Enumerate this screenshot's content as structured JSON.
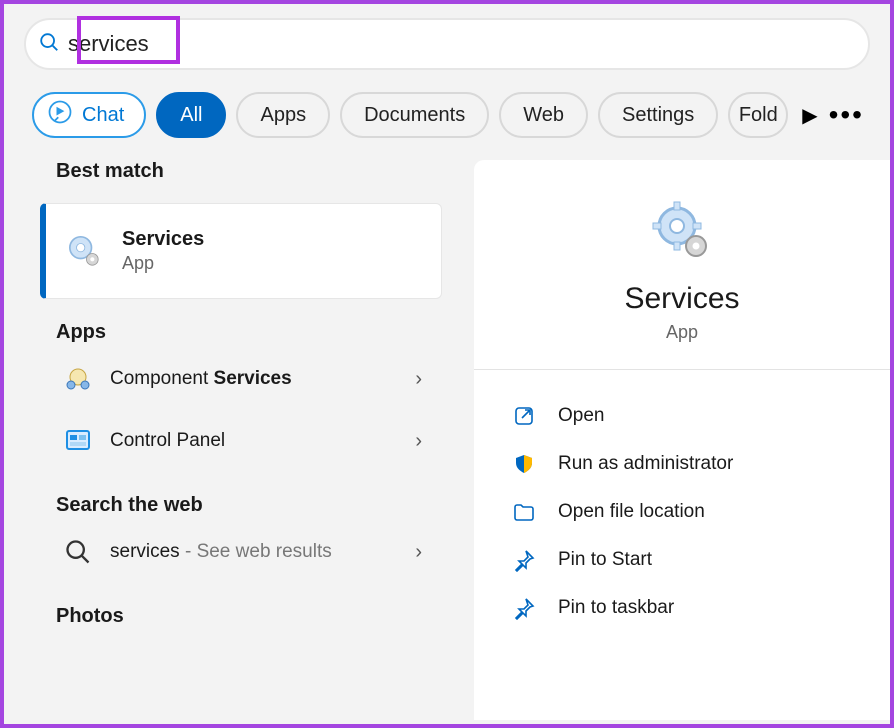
{
  "search": {
    "query": "services"
  },
  "filters": {
    "chat": "Chat",
    "all": "All",
    "apps": "Apps",
    "documents": "Documents",
    "web": "Web",
    "settings": "Settings",
    "folders": "Fold"
  },
  "sections": {
    "best_match": "Best match",
    "apps": "Apps",
    "search_web": "Search the web",
    "photos": "Photos"
  },
  "best": {
    "title": "Services",
    "subtitle": "App"
  },
  "apps_list": {
    "component_pre": "Component ",
    "component_bold": "Services",
    "control_panel": "Control Panel"
  },
  "web": {
    "term": "services",
    "hint": " - See web results"
  },
  "detail": {
    "title": "Services",
    "subtitle": "App",
    "open": "Open",
    "admin": "Run as administrator",
    "loc": "Open file location",
    "pin_start": "Pin to Start",
    "pin_task": "Pin to taskbar"
  }
}
